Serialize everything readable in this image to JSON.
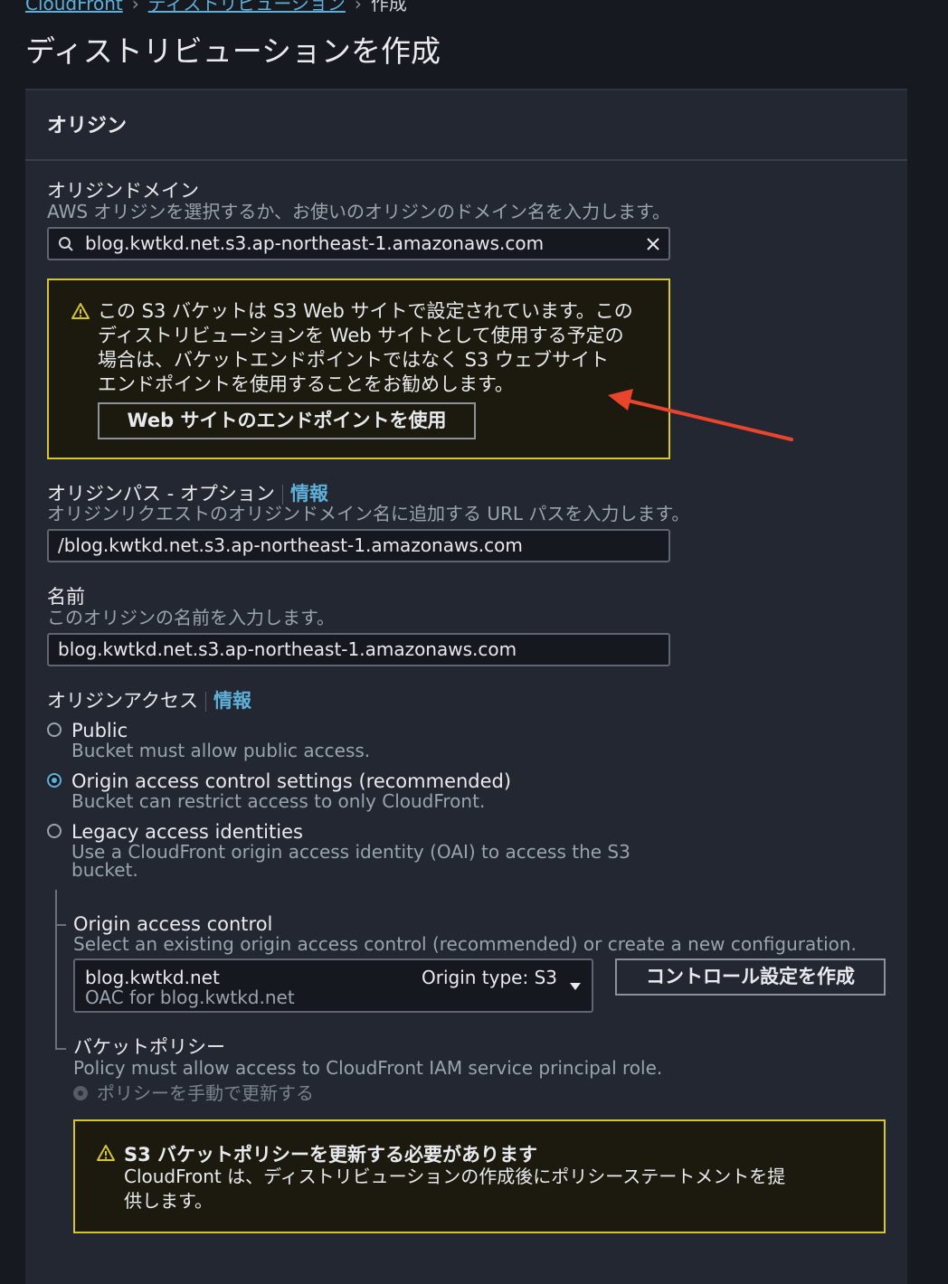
{
  "breadcrumb": {
    "items": [
      "CloudFront",
      "ディストリビューション",
      "作成"
    ]
  },
  "page_title": "ディストリビューションを作成",
  "panel_title": "オリジン",
  "origin_domain": {
    "label": "オリジンドメイン",
    "description": "AWS オリジンを選択するか、お使いのオリジンのドメイン名を入力します。",
    "value": "blog.kwtkd.net.s3.ap-northeast-1.amazonaws.com"
  },
  "website_warning": {
    "lines": [
      "この S3 バケットは S3 Web サイトで設定されています。この",
      "ディストリビューションを Web サイトとして使用する予定の",
      "場合は、バケットエンドポイントではなく S3 ウェブサイト",
      "エンドポイントを使用することをお勧めします。"
    ],
    "button": "Web サイトのエンドポイントを使用"
  },
  "origin_path": {
    "label": "オリジンパス - オプション",
    "info": "情報",
    "description": "オリジンリクエストのオリジンドメイン名に追加する URL パスを入力します。",
    "value": "/blog.kwtkd.net.s3.ap-northeast-1.amazonaws.com"
  },
  "name": {
    "label": "名前",
    "description": "このオリジンの名前を入力します。",
    "value": "blog.kwtkd.net.s3.ap-northeast-1.amazonaws.com"
  },
  "origin_access": {
    "label": "オリジンアクセス",
    "info": "情報",
    "options": [
      {
        "label": "Public",
        "desc": "Bucket must allow public access.",
        "selected": false
      },
      {
        "label": "Origin access control settings (recommended)",
        "desc": "Bucket can restrict access to only CloudFront.",
        "selected": true
      },
      {
        "label": "Legacy access identities",
        "desc1": "Use a CloudFront origin access identity (OAI) to access the S3",
        "desc2": "bucket.",
        "selected": false
      }
    ]
  },
  "oac": {
    "label": "Origin access control",
    "description": "Select an existing origin access control (recommended) or create a new configuration.",
    "selected_name": "blog.kwtkd.net",
    "selected_desc": "OAC for blog.kwtkd.net",
    "origin_type": "Origin type: S3",
    "create_button": "コントロール設定を作成"
  },
  "bucket_policy": {
    "label": "バケットポリシー",
    "description": "Policy must allow access to CloudFront IAM service principal role.",
    "option": "ポリシーを手動で更新する"
  },
  "policy_warning": {
    "title": "S3 バケットポリシーを更新する必要があります",
    "line1": "CloudFront は、ディストリビューションの作成後にポリシーステートメントを提",
    "line2": "供します。"
  },
  "colors": {
    "background": "#16191f",
    "panel": "#222731",
    "link": "#5fb0d9",
    "warning_border": "#d7c52e",
    "arrow": "#e8452c"
  }
}
